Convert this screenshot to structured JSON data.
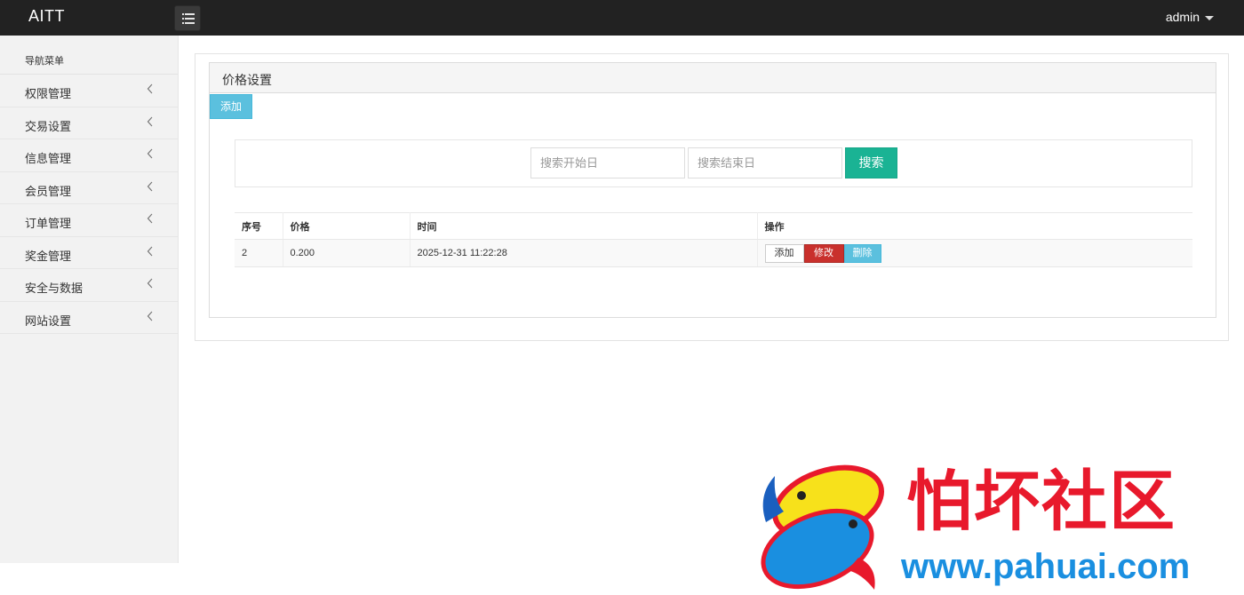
{
  "app": {
    "brand": "AITT",
    "user": "admin"
  },
  "sidebar": {
    "heading": "导航菜单",
    "items": [
      {
        "label": "权限管理"
      },
      {
        "label": "交易设置"
      },
      {
        "label": "信息管理"
      },
      {
        "label": "会员管理"
      },
      {
        "label": "订单管理"
      },
      {
        "label": "奖金管理"
      },
      {
        "label": "安全与数据"
      },
      {
        "label": "网站设置"
      }
    ]
  },
  "panel": {
    "title": "价格设置",
    "add_label": "添加",
    "search": {
      "start_placeholder": "搜索开始日",
      "end_placeholder": "搜索结束日",
      "button_label": "搜索"
    },
    "table": {
      "headers": [
        "序号",
        "价格",
        "时间",
        "操作"
      ],
      "rows": [
        {
          "id": "2",
          "price": "0.200",
          "time": "2025-12-31 11:22:28"
        }
      ],
      "row_actions": {
        "add": "添加",
        "edit": "修改",
        "delete": "删除"
      }
    }
  },
  "watermark": {
    "title": "怕坏社区",
    "url": "www.pahuai.com"
  },
  "colors": {
    "topbar": "#222222",
    "info": "#5bc0de",
    "primary": "#1ab394",
    "danger": "#c9302c",
    "watermark_red": "#e8192c",
    "watermark_blue": "#1a8fe0"
  }
}
